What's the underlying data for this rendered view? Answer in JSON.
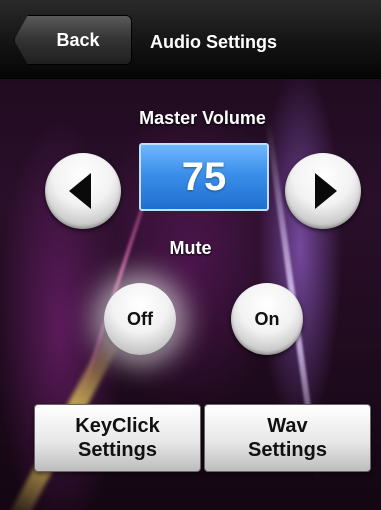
{
  "header": {
    "back_label": "Back",
    "title": "Audio Settings"
  },
  "volume": {
    "label": "Master Volume",
    "value": "75"
  },
  "mute": {
    "label": "Mute",
    "options": [
      "Off",
      "On"
    ],
    "selected": "Off"
  },
  "footer": {
    "keyclick_line1": "KeyClick",
    "keyclick_line2": "Settings",
    "wav_line1": "Wav",
    "wav_line2": "Settings"
  },
  "colors": {
    "volume_accent": "#3b8fea",
    "header_bg": "#141414"
  }
}
